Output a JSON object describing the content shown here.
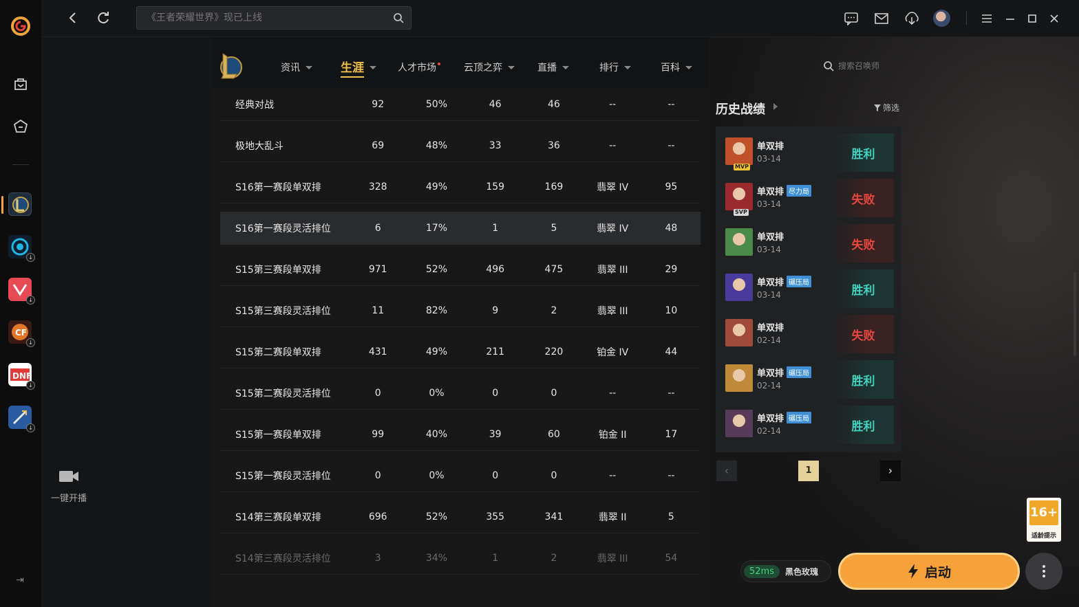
{
  "topbar": {
    "search_placeholder": "《王者荣耀世界》现已上线"
  },
  "sidebar": {
    "stream_label": "一键开播"
  },
  "game_nav": {
    "tabs": [
      {
        "label": "资讯"
      },
      {
        "label": "生涯"
      },
      {
        "label": "人才市场"
      },
      {
        "label": "云顶之弈"
      },
      {
        "label": "直播"
      },
      {
        "label": "排行"
      },
      {
        "label": "百科"
      }
    ],
    "summoner_search_placeholder": "搜索召唤师"
  },
  "career_table": {
    "rows": [
      [
        "经典对战",
        "92",
        "50%",
        "46",
        "46",
        "--",
        "--"
      ],
      [
        "极地大乱斗",
        "69",
        "48%",
        "33",
        "36",
        "--",
        "--"
      ],
      [
        "S16第一赛段单双排",
        "328",
        "49%",
        "159",
        "169",
        "翡翠 IV",
        "95"
      ],
      [
        "S16第一赛段灵活排位",
        "6",
        "17%",
        "1",
        "5",
        "翡翠 IV",
        "48"
      ],
      [
        "S15第三赛段单双排",
        "971",
        "52%",
        "496",
        "475",
        "翡翠 III",
        "29"
      ],
      [
        "S15第三赛段灵活排位",
        "11",
        "82%",
        "9",
        "2",
        "翡翠 III",
        "10"
      ],
      [
        "S15第二赛段单双排",
        "431",
        "49%",
        "211",
        "220",
        "铂金 IV",
        "44"
      ],
      [
        "S15第二赛段灵活排位",
        "0",
        "0%",
        "0",
        "0",
        "--",
        "--"
      ],
      [
        "S15第一赛段单双排",
        "99",
        "40%",
        "39",
        "60",
        "铂金 II",
        "17"
      ],
      [
        "S15第一赛段灵活排位",
        "0",
        "0%",
        "0",
        "0",
        "--",
        "--"
      ],
      [
        "S14第三赛段单双排",
        "696",
        "52%",
        "355",
        "341",
        "翡翠 II",
        "5"
      ],
      [
        "S14第三赛段灵活排位",
        "3",
        "34%",
        "1",
        "2",
        "翡翠 III",
        "54"
      ]
    ]
  },
  "history": {
    "title": "历史战绩",
    "filter_label": "筛选",
    "matches": [
      {
        "mode": "单双排",
        "tag": "",
        "date": "03-14",
        "result": "胜利",
        "badge": "MVP",
        "color": "#c0502a"
      },
      {
        "mode": "单双排",
        "tag": "尽力局",
        "date": "03-14",
        "result": "失败",
        "badge": "SVP",
        "color": "#9a2a30"
      },
      {
        "mode": "单双排",
        "tag": "",
        "date": "03-14",
        "result": "失败",
        "badge": "",
        "color": "#4a8a4a"
      },
      {
        "mode": "单双排",
        "tag": "碾压局",
        "date": "03-14",
        "result": "胜利",
        "badge": "",
        "color": "#4a3a9a"
      },
      {
        "mode": "单双排",
        "tag": "",
        "date": "02-14",
        "result": "失败",
        "badge": "",
        "color": "#a04a3a"
      },
      {
        "mode": "单双排",
        "tag": "碾压局",
        "date": "02-14",
        "result": "胜利",
        "badge": "",
        "color": "#c08a3a"
      },
      {
        "mode": "单双排",
        "tag": "碾压局",
        "date": "02-14",
        "result": "胜利",
        "badge": "",
        "color": "#5a3a5a"
      }
    ],
    "page": "1"
  },
  "launch": {
    "ping": "52ms",
    "server": "黑色玫瑰",
    "label": "启动"
  },
  "age_rating": {
    "number": "16+",
    "label": "适龄提示"
  }
}
